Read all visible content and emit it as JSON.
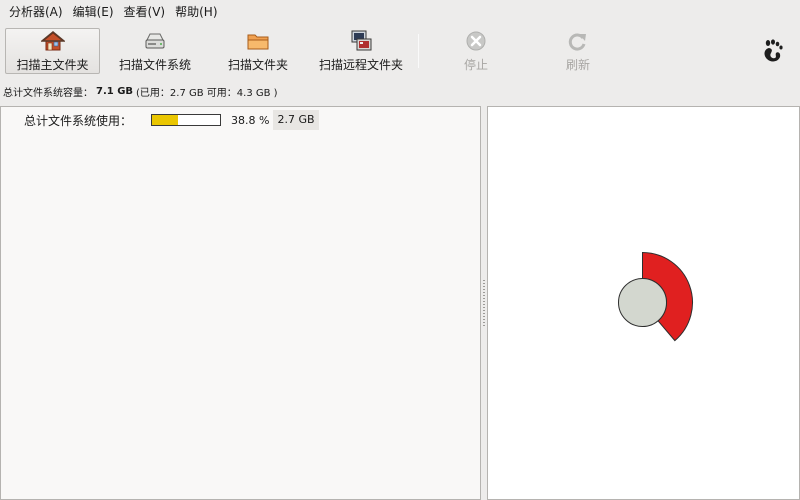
{
  "menu": [
    {
      "label": "分析器(A)"
    },
    {
      "label": "编辑(E)"
    },
    {
      "label": "查看(V)"
    },
    {
      "label": "帮助(H)"
    }
  ],
  "toolbar": {
    "scan_home": {
      "label": "扫描主文件夹",
      "icon": "home-icon"
    },
    "scan_fs": {
      "label": "扫描文件系统",
      "icon": "drive-icon"
    },
    "scan_folder": {
      "label": "扫描文件夹",
      "icon": "folder-icon"
    },
    "scan_remote": {
      "label": "扫描远程文件夹",
      "icon": "network-icon"
    },
    "stop": {
      "label": "停止",
      "icon": "stop-icon"
    },
    "refresh": {
      "label": "刷新",
      "icon": "refresh-icon"
    },
    "gnome": {
      "icon": "gnome-foot-icon"
    }
  },
  "capacity": {
    "label": "总计文件系统容量：",
    "total": "7.1 GB",
    "detail": "(已用：2.7 GB 可用：4.3 GB )"
  },
  "tree": {
    "rows": [
      {
        "name": "总计文件系统使用：",
        "fraction": 0.388,
        "percent": "38.8 %",
        "size": "2.7 GB"
      }
    ]
  },
  "ring": {
    "used_fraction": 0.388,
    "colors": {
      "center": "#d3d7cf",
      "segment": "#e02020",
      "outline": "#2e2e2e"
    }
  },
  "colors": {
    "bar_fill": "#eac600"
  }
}
